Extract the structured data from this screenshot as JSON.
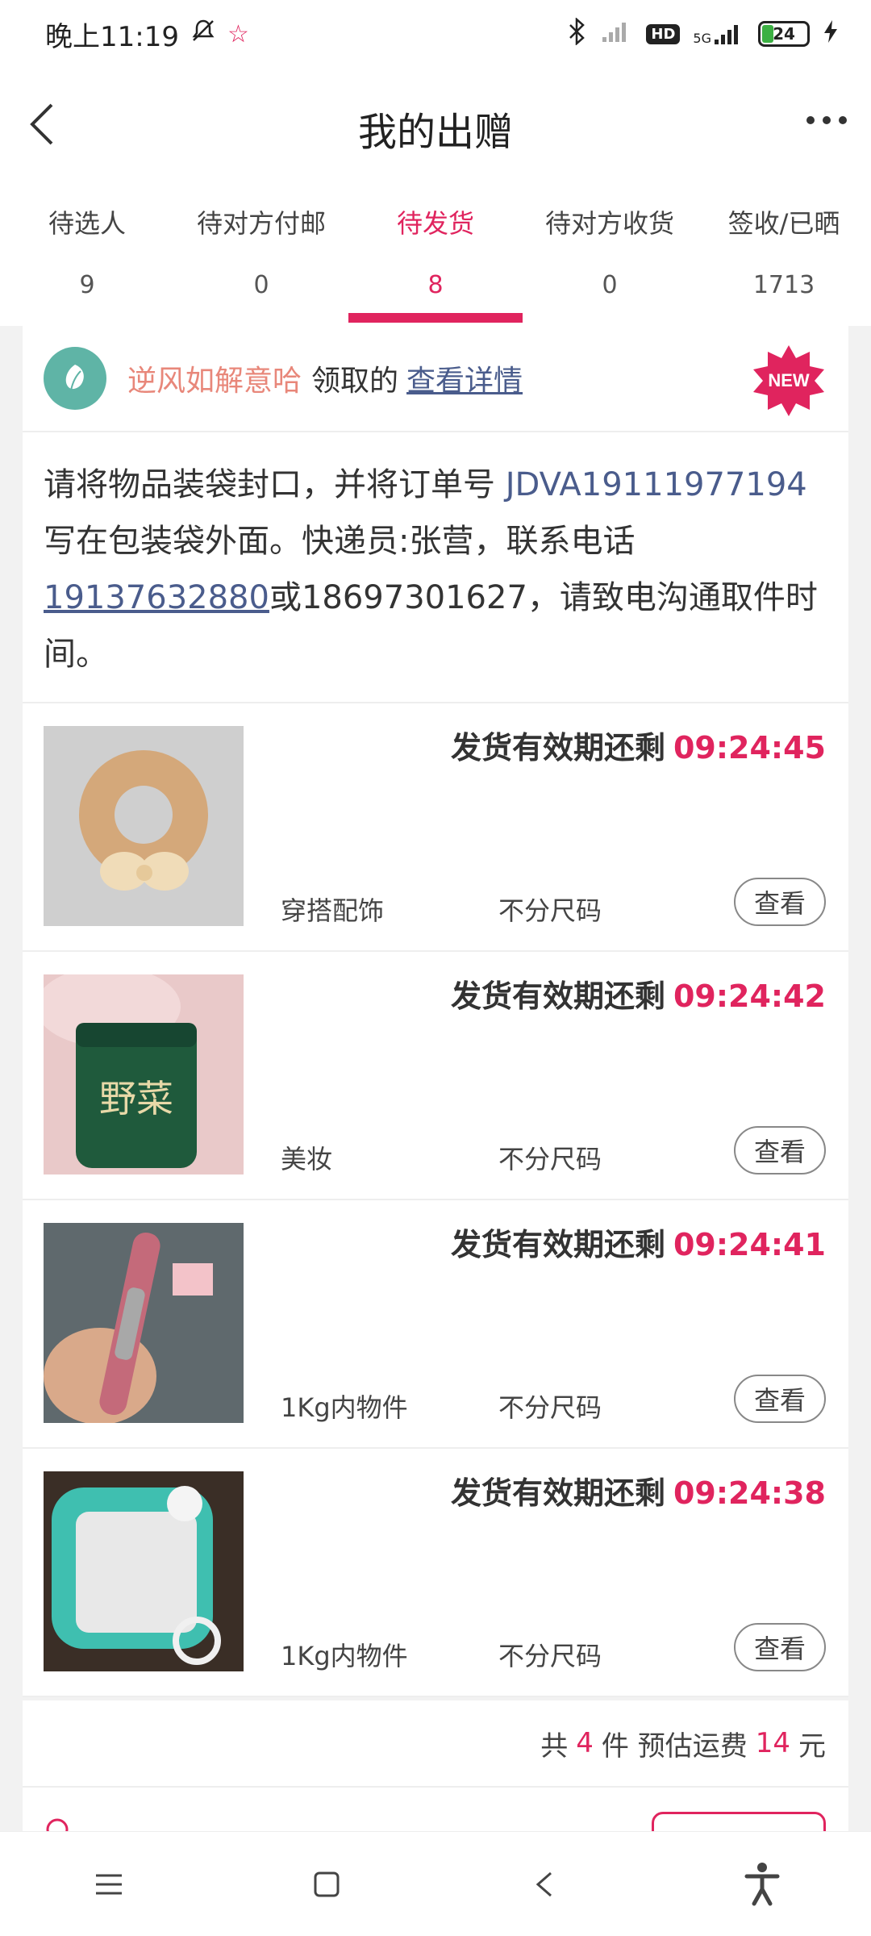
{
  "status_bar": {
    "time": "晚上11:19",
    "network": "5G",
    "hd": "HD",
    "battery": "24"
  },
  "header": {
    "title": "我的出赠"
  },
  "tabs": [
    {
      "label": "待选人",
      "count": "9"
    },
    {
      "label": "待对方付邮",
      "count": "0"
    },
    {
      "label": "待发货",
      "count": "8"
    },
    {
      "label": "待对方收货",
      "count": "0"
    },
    {
      "label": "签收/已晒",
      "count": "1713"
    }
  ],
  "donor": {
    "name": "逆风如解意哈",
    "text": "领取的",
    "link": "查看详情",
    "badge": "NEW"
  },
  "notice": {
    "part1": "请将物品装袋封口，并将订单号 ",
    "order_no": "JDVA19111977194",
    "part2": " 写在包装袋外面。快递员:张营，联系电话",
    "phone1": "19137632880",
    "part3": "或18697301627，请致电沟通取件时间。"
  },
  "items": [
    {
      "deadline_label": "发货有效期还剩",
      "time": "09:24:45",
      "category": "穿搭配饰",
      "size": "不分尺码",
      "action": "查看"
    },
    {
      "deadline_label": "发货有效期还剩",
      "time": "09:24:42",
      "category": "美妆",
      "size": "不分尺码",
      "action": "查看"
    },
    {
      "deadline_label": "发货有效期还剩",
      "time": "09:24:41",
      "category": "1Kg内物件",
      "size": "不分尺码",
      "action": "查看"
    },
    {
      "deadline_label": "发货有效期还剩",
      "time": "09:24:38",
      "category": "1Kg内物件",
      "size": "不分尺码",
      "action": "查看"
    }
  ],
  "summary": {
    "prefix": "共",
    "count": "4",
    "mid": "件 预估运费",
    "fee": "14",
    "suffix": "元"
  },
  "colors": {
    "accent": "#e0245e",
    "link": "#4a5c8c",
    "donor_name": "#e8877a"
  }
}
